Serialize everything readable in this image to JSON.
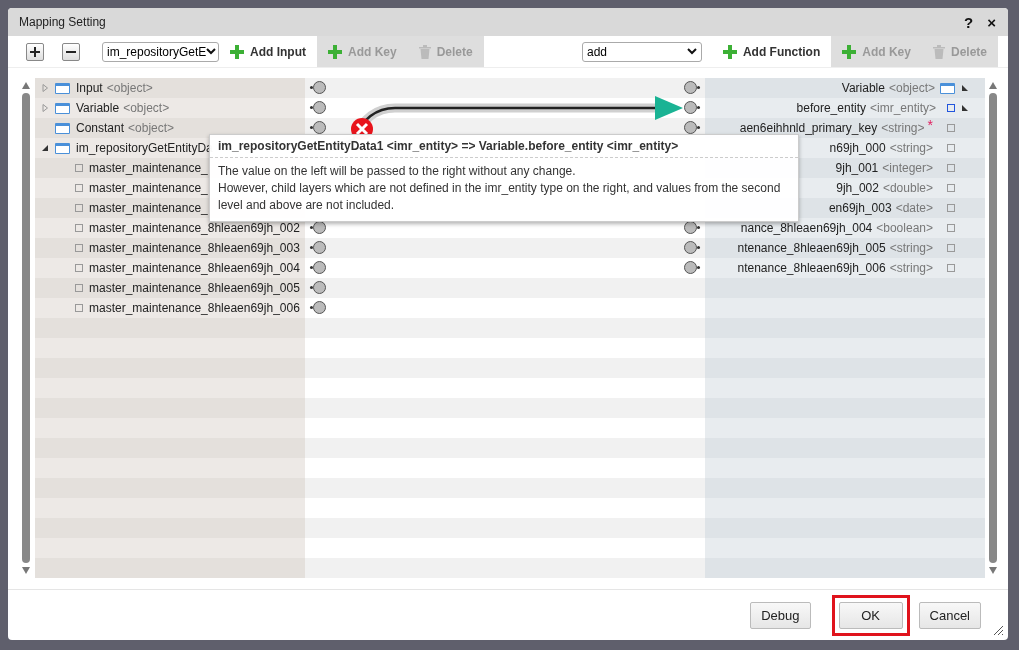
{
  "window": {
    "title": "Mapping Setting",
    "help": "?",
    "close": "×"
  },
  "toolbar": {
    "left": [
      {
        "kind": "expand"
      },
      {
        "kind": "collapse"
      },
      {
        "kind": "select",
        "value": "im_repositoryGetE"
      },
      {
        "kind": "add",
        "label": "Add Input",
        "disabled": false
      },
      {
        "kind": "add",
        "label": "Add Key",
        "disabled": true
      },
      {
        "kind": "delete",
        "label": "Delete",
        "disabled": true
      }
    ],
    "right": [
      {
        "kind": "select",
        "value": "add"
      },
      {
        "kind": "add",
        "label": "Add Function",
        "disabled": false
      },
      {
        "kind": "add",
        "label": "Add Key",
        "disabled": true
      },
      {
        "kind": "delete",
        "label": "Delete",
        "disabled": true
      }
    ]
  },
  "source_tree": [
    {
      "name": "Input",
      "type": "<object>",
      "expanded": false
    },
    {
      "name": "Variable",
      "type": "<object>",
      "expanded": false
    },
    {
      "name": "Constant",
      "type": "<object>"
    },
    {
      "name": "im_repositoryGetEntityDa",
      "expanded": true,
      "children": [
        {
          "name": "master_maintenance_"
        },
        {
          "name": "master_maintenance_"
        },
        {
          "name": "master_maintenance_"
        },
        {
          "name": "master_maintenance_8hleaen69jh_002"
        },
        {
          "name": "master_maintenance_8hleaen69jh_003"
        },
        {
          "name": "master_maintenance_8hleaen69jh_004"
        },
        {
          "name": "master_maintenance_8hleaen69jh_005"
        },
        {
          "name": "master_maintenance_8hleaen69jh_006"
        }
      ]
    }
  ],
  "target_tree": [
    {
      "name": "Variable",
      "type": "<object>",
      "expanded": true,
      "children": [
        {
          "name": "before_entity",
          "type": "<imr_entity>",
          "expanded": true,
          "children": [
            {
              "name": "aen6eihhnld_primary_key",
              "type": "<string>",
              "required_mark": "*"
            },
            {
              "name": "n69jh_000",
              "type": "<string>"
            },
            {
              "name": "9jh_001",
              "type": "<integer>"
            },
            {
              "name": "9jh_002",
              "type": "<double>"
            },
            {
              "name": "en69jh_003",
              "type": "<date>"
            },
            {
              "name": "nance_8hleaen69jh_004",
              "type": "<boolean>"
            },
            {
              "name": "ntenance_8hleaen69jh_005",
              "type": "<string>"
            },
            {
              "name": "ntenance_8hleaen69jh_006",
              "type": "<string>"
            }
          ]
        }
      ]
    }
  ],
  "tooltip": {
    "title": "im_repositoryGetEntityData1 <imr_entity> => Variable.before_entity <imr_entity>",
    "lines": [
      "The value on the left will be passed to the right without any change.",
      "However, child layers which are not defined in the imr_entity type on the right, and values from the second level and above are not included."
    ]
  },
  "buttons": [
    {
      "label": "Debug",
      "highlighted": false
    },
    {
      "label": "OK",
      "highlighted": true
    },
    {
      "label": "Cancel",
      "highlighted": false
    }
  ]
}
